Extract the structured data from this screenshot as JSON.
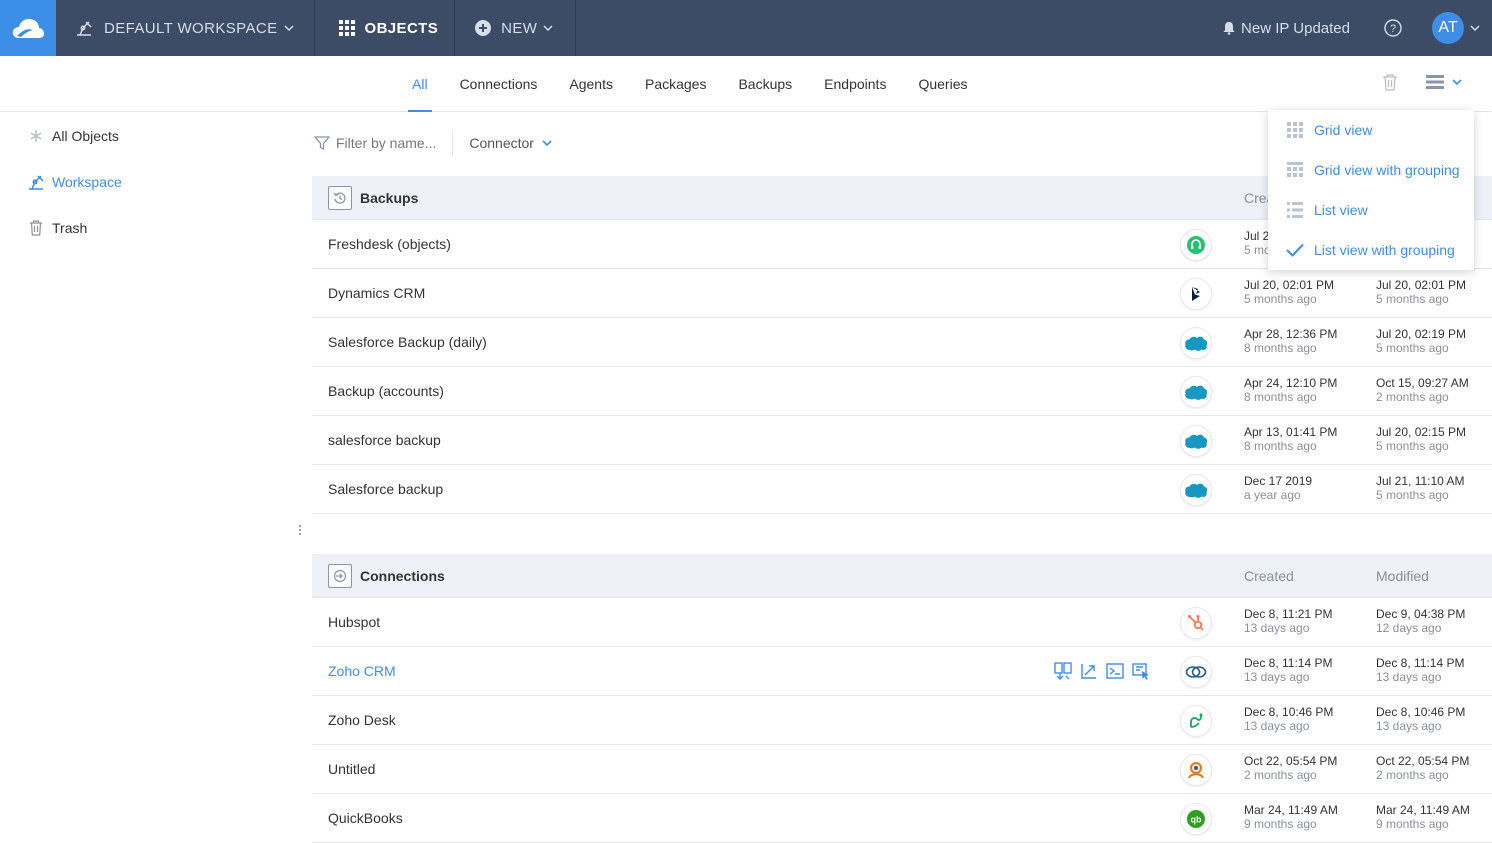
{
  "topbar": {
    "workspace_label": "DEFAULT WORKSPACE",
    "objects_label": "OBJECTS",
    "new_label": "NEW",
    "notification_text": "New IP Updated",
    "avatar_initials": "AT"
  },
  "tabs": [
    "All",
    "Connections",
    "Agents",
    "Packages",
    "Backups",
    "Endpoints",
    "Queries"
  ],
  "active_tab": "All",
  "sidebar": {
    "items": [
      {
        "label": "All Objects",
        "icon": "asterisk-icon"
      },
      {
        "label": "Workspace",
        "icon": "workspace-icon"
      },
      {
        "label": "Trash",
        "icon": "trash-icon"
      }
    ]
  },
  "filter": {
    "placeholder": "Filter by name...",
    "connector_label": "Connector"
  },
  "view_menu": {
    "items": [
      {
        "label": "Grid view",
        "icon": "grid-icon",
        "checked": false
      },
      {
        "label": "Grid view with grouping",
        "icon": "grid-icon",
        "checked": false
      },
      {
        "label": "List view",
        "icon": "list-icon",
        "checked": false
      },
      {
        "label": "List view with grouping",
        "icon": "check-icon",
        "checked": true
      }
    ]
  },
  "groups": {
    "backups": {
      "title": "Backups",
      "col_created": "Crea",
      "col_modified": "",
      "rows": [
        {
          "name": "Freshdesk (objects)",
          "logo": "freshdesk-logo",
          "created": "Jul 2",
          "created_ago": "5 mo",
          "modified": "",
          "modified_ago": ""
        },
        {
          "name": "Dynamics CRM",
          "logo": "dynamics-logo",
          "created": "Jul 20, 02:01 PM",
          "created_ago": "5 months ago",
          "modified": "Jul 20, 02:01 PM",
          "modified_ago": "5 months ago"
        },
        {
          "name": "Salesforce Backup (daily)",
          "logo": "salesforce-logo",
          "created": "Apr 28, 12:36 PM",
          "created_ago": "8 months ago",
          "modified": "Jul 20, 02:19 PM",
          "modified_ago": "5 months ago"
        },
        {
          "name": "Backup (accounts)",
          "logo": "salesforce-logo",
          "created": "Apr 24, 12:10 PM",
          "created_ago": "8 months ago",
          "modified": "Oct 15, 09:27 AM",
          "modified_ago": "2 months ago"
        },
        {
          "name": "salesforce backup",
          "logo": "salesforce-logo",
          "created": "Apr 13, 01:41 PM",
          "created_ago": "8 months ago",
          "modified": "Jul 20, 02:15 PM",
          "modified_ago": "5 months ago"
        },
        {
          "name": "Salesforce backup",
          "logo": "salesforce-logo",
          "created": "Dec 17 2019",
          "created_ago": "a year ago",
          "modified": "Jul 21, 11:10 AM",
          "modified_ago": "5 months ago"
        }
      ]
    },
    "connections": {
      "title": "Connections",
      "col_created": "Created",
      "col_modified": "Modified",
      "rows": [
        {
          "name": "Hubspot",
          "logo": "hubspot-logo",
          "created": "Dec 8, 11:21 PM",
          "created_ago": "13 days ago",
          "modified": "Dec 9, 04:38 PM",
          "modified_ago": "12 days ago"
        },
        {
          "name": "Zoho CRM",
          "logo": "zoho-crm-logo",
          "created": "Dec 8, 11:14 PM",
          "created_ago": "13 days ago",
          "modified": "Dec 8, 11:14 PM",
          "modified_ago": "13 days ago",
          "hovered": true
        },
        {
          "name": "Zoho Desk",
          "logo": "zoho-desk-logo",
          "created": "Dec 8, 10:46 PM",
          "created_ago": "13 days ago",
          "modified": "Dec 8, 10:46 PM",
          "modified_ago": "13 days ago"
        },
        {
          "name": "Untitled",
          "logo": "untitled-logo",
          "created": "Oct 22, 05:54 PM",
          "created_ago": "2 months ago",
          "modified": "Oct 22, 05:54 PM",
          "modified_ago": "2 months ago"
        },
        {
          "name": "QuickBooks",
          "logo": "quickbooks-logo",
          "created": "Mar 24, 11:49 AM",
          "created_ago": "9 months ago",
          "modified": "Mar 24, 11:49 AM",
          "modified_ago": "9 months ago"
        }
      ]
    }
  },
  "colors": {
    "topbar": "#3c4b66",
    "accent": "#3d8ee6",
    "group_header_bg": "#eef2f8"
  }
}
